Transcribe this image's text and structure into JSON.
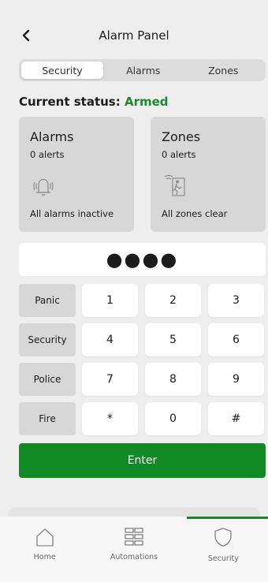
{
  "header": {
    "title": "Alarm Panel",
    "back_icon": "chevron-left-icon"
  },
  "tabs": [
    {
      "label": "Security",
      "active": true
    },
    {
      "label": "Alarms",
      "active": false
    },
    {
      "label": "Zones",
      "active": false
    }
  ],
  "status": {
    "label": "Current status:",
    "value": "Armed",
    "value_color": "#1a8a2e"
  },
  "cards": {
    "alarms": {
      "title": "Alarms",
      "count": "0 alerts",
      "footer": "All alarms inactive",
      "icon": "bell-ringing-icon"
    },
    "zones": {
      "title": "Zones",
      "count": "0 alerts",
      "footer": "All zones clear",
      "icon": "motion-sensor-icon"
    }
  },
  "pin": {
    "masked": "●●●●"
  },
  "keypad": {
    "functions": [
      "Panic",
      "Security",
      "Police",
      "Fire"
    ],
    "rows": [
      [
        "1",
        "2",
        "3"
      ],
      [
        "4",
        "5",
        "6"
      ],
      [
        "7",
        "8",
        "9"
      ],
      [
        "*",
        "0",
        "#"
      ]
    ]
  },
  "enter": {
    "label": "Enter",
    "color": "#128a24"
  },
  "nav": [
    {
      "label": "Home",
      "icon": "home-icon",
      "active": false
    },
    {
      "label": "Automations",
      "icon": "grid-icon",
      "active": false
    },
    {
      "label": "Security",
      "icon": "shield-icon",
      "active": true
    }
  ],
  "accent": "#128a24"
}
